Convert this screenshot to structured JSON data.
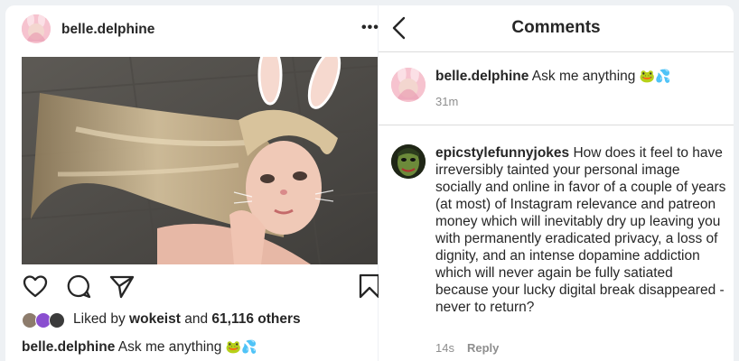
{
  "post": {
    "username": "belle.delphine",
    "more_label": "•••",
    "likes": {
      "prefix": "Liked by ",
      "user": "wokeist",
      "middle": " and ",
      "count": "61,116 others"
    },
    "caption": {
      "username": "belle.delphine",
      "text": " Ask me anything ",
      "emoji": "🐸💦"
    }
  },
  "comments_panel": {
    "title": "Comments",
    "op_comment": {
      "username": "belle.delphine",
      "text": " Ask me anything ",
      "emoji": "🐸💦",
      "time": "31m"
    },
    "reply_comment": {
      "username": "epicstylefunnyjokes",
      "text": " How does it feel to have irreversibly tainted your personal image socially and online in favor of a couple of years (at most) of Instagram relevance and patreon money which will inevitably dry up leaving you with permanently eradicated privacy, a loss of dignity, and an intense dopamine addiction which will never again be fully satiated because your lucky digital break disappeared - never to return?",
      "time": "14s",
      "reply_label": "Reply"
    }
  },
  "colors": {
    "text": "#262626",
    "muted": "#8e8e8e",
    "divider": "#dbdbdb",
    "avatar_pink": "#f4b7c6"
  },
  "icons": [
    "more-icon",
    "heart-icon",
    "comment-icon",
    "share-icon",
    "bookmark-icon",
    "back-icon"
  ]
}
